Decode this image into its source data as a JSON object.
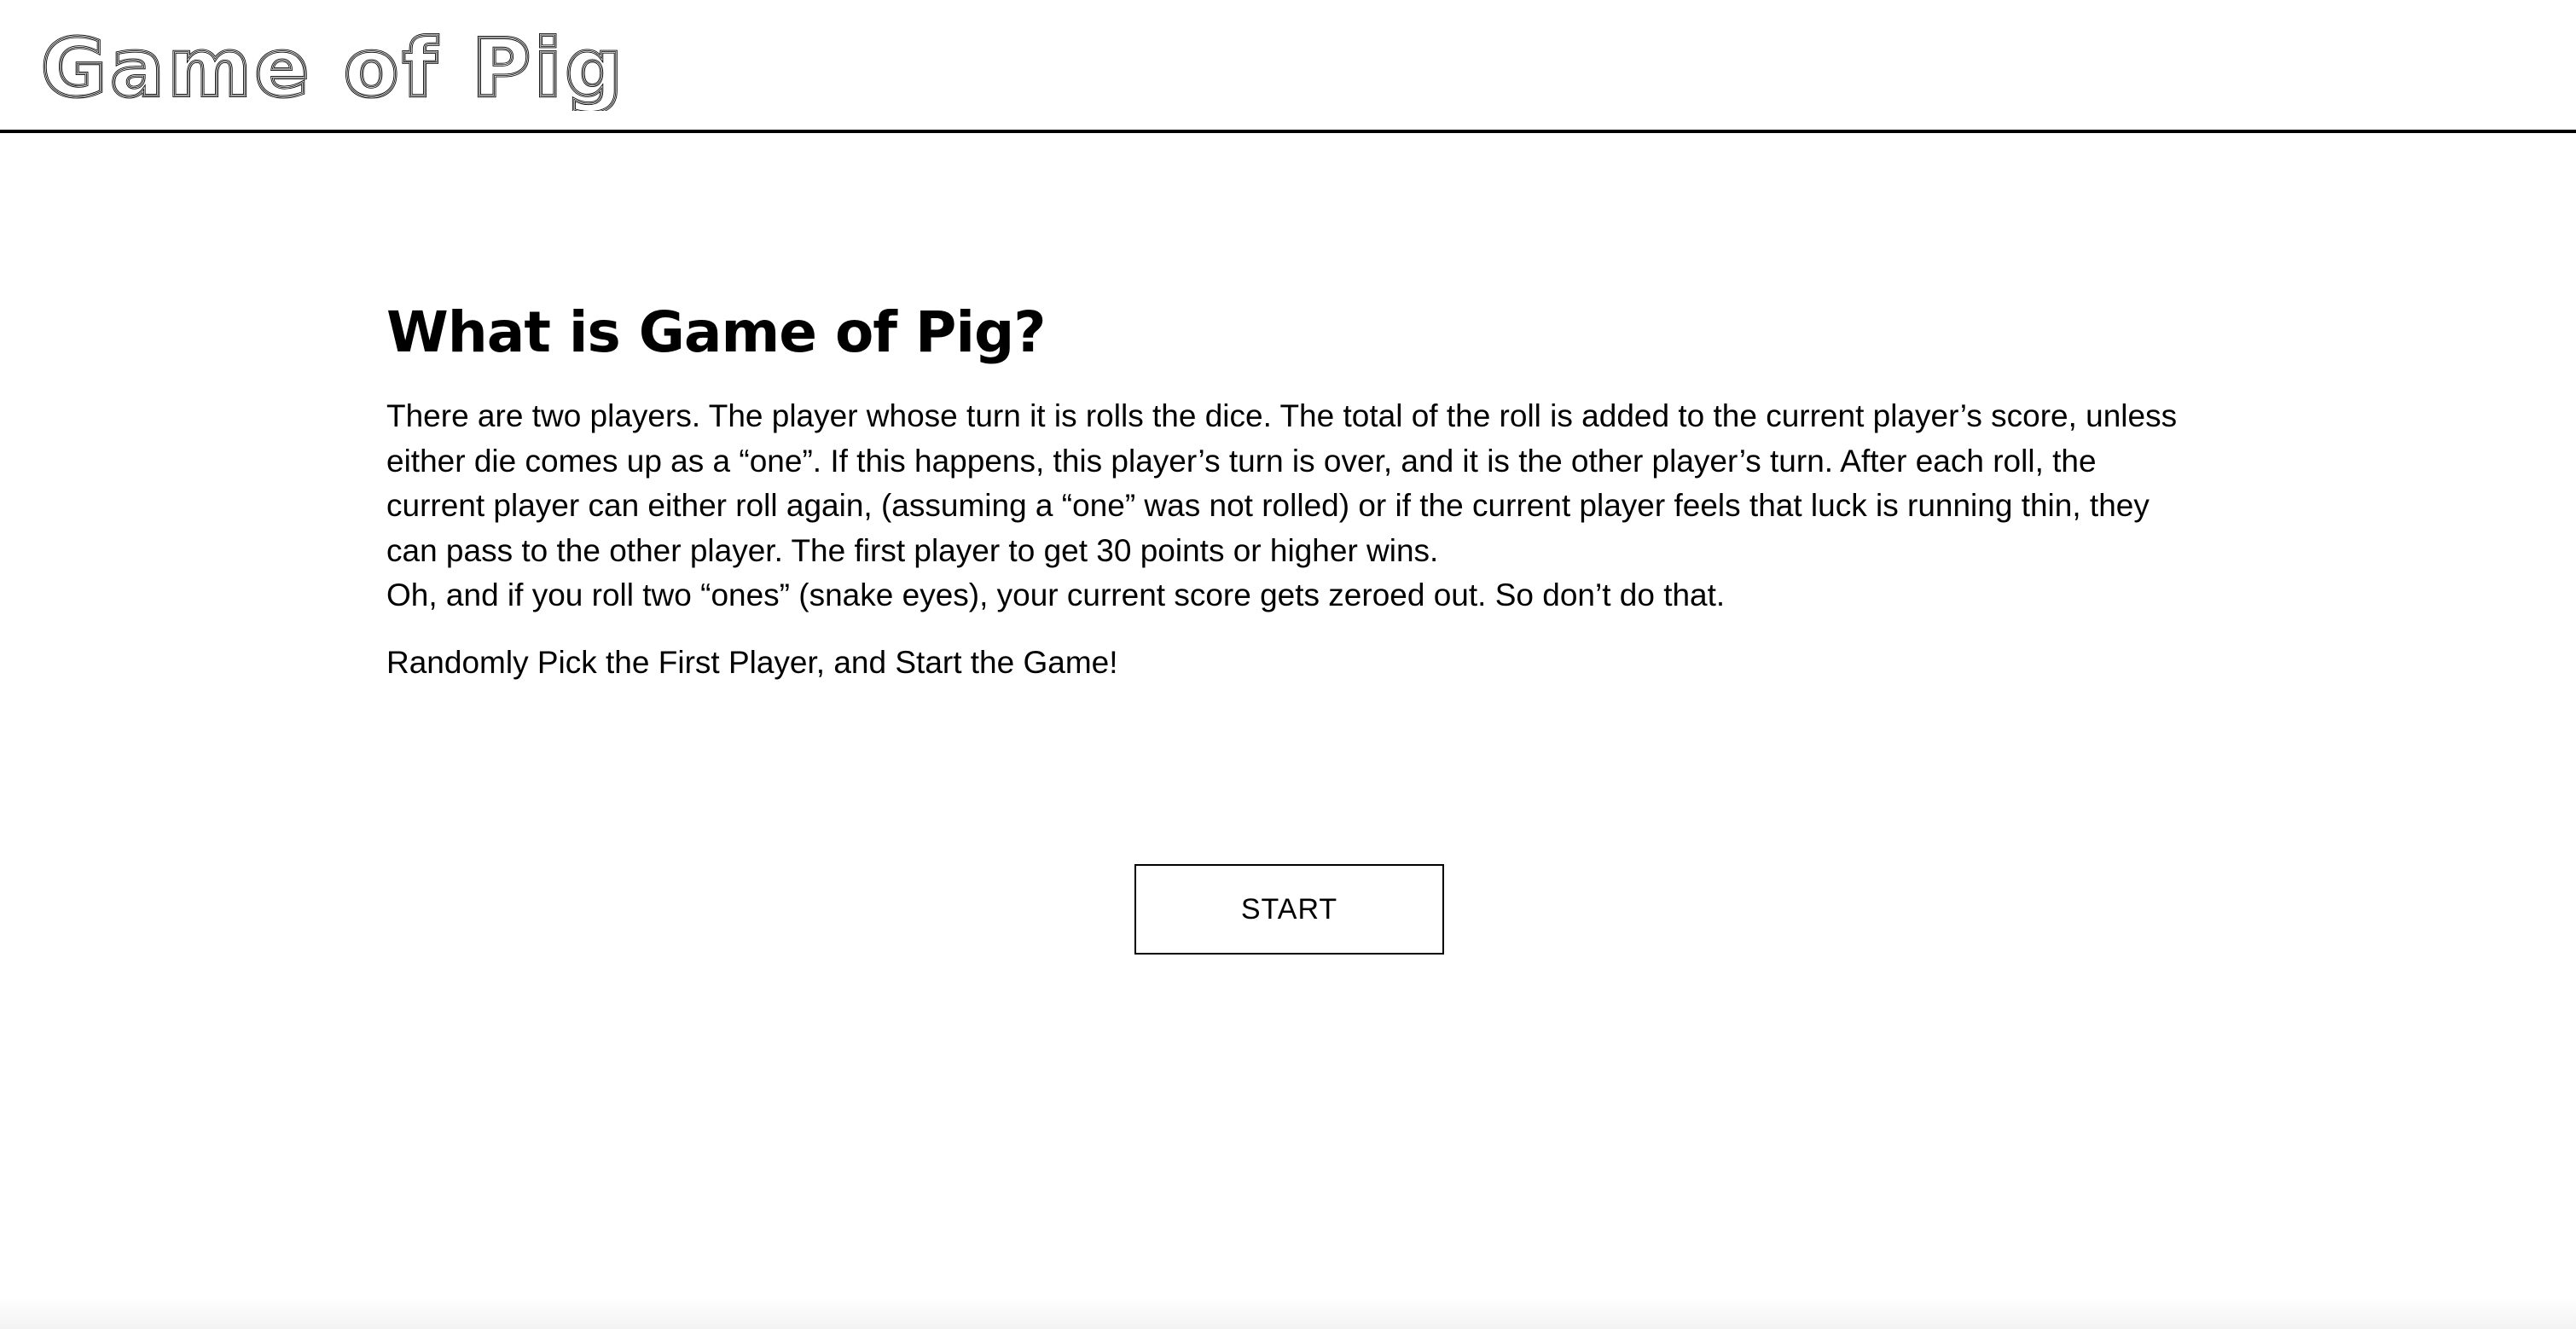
{
  "header": {
    "logo_text": "Game of Pig"
  },
  "main": {
    "title": "What is Game of Pig?",
    "description": [
      "There are two players. The player whose turn it is rolls the dice. The total of the roll is added to the current player’s score, unless either die comes up as a “one”. If this happens, this player’s turn is over, and it is the other player’s turn. After each roll, the current player can either roll again, (assuming a “one” was not rolled) or if the current player feels that luck is running thin, they can pass to the other player. The first player to get 30 points or higher wins.",
      "Oh, and if you roll two “ones” (snake eyes), your current score gets zeroed out. So don’t do that."
    ],
    "cta_text": "Randomly Pick the First Player, and Start the Game!",
    "start_label": "START"
  },
  "colors": {
    "text": "#000000",
    "background": "#ffffff",
    "border": "#000000"
  }
}
